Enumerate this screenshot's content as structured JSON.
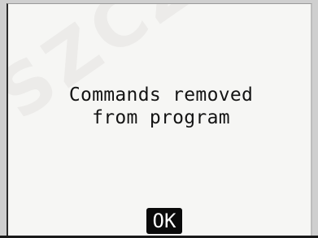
{
  "dialog": {
    "message_line1": "Commands removed",
    "message_line2": "from program",
    "ok_label": "OK"
  },
  "watermark": "SZCZEPANIK"
}
